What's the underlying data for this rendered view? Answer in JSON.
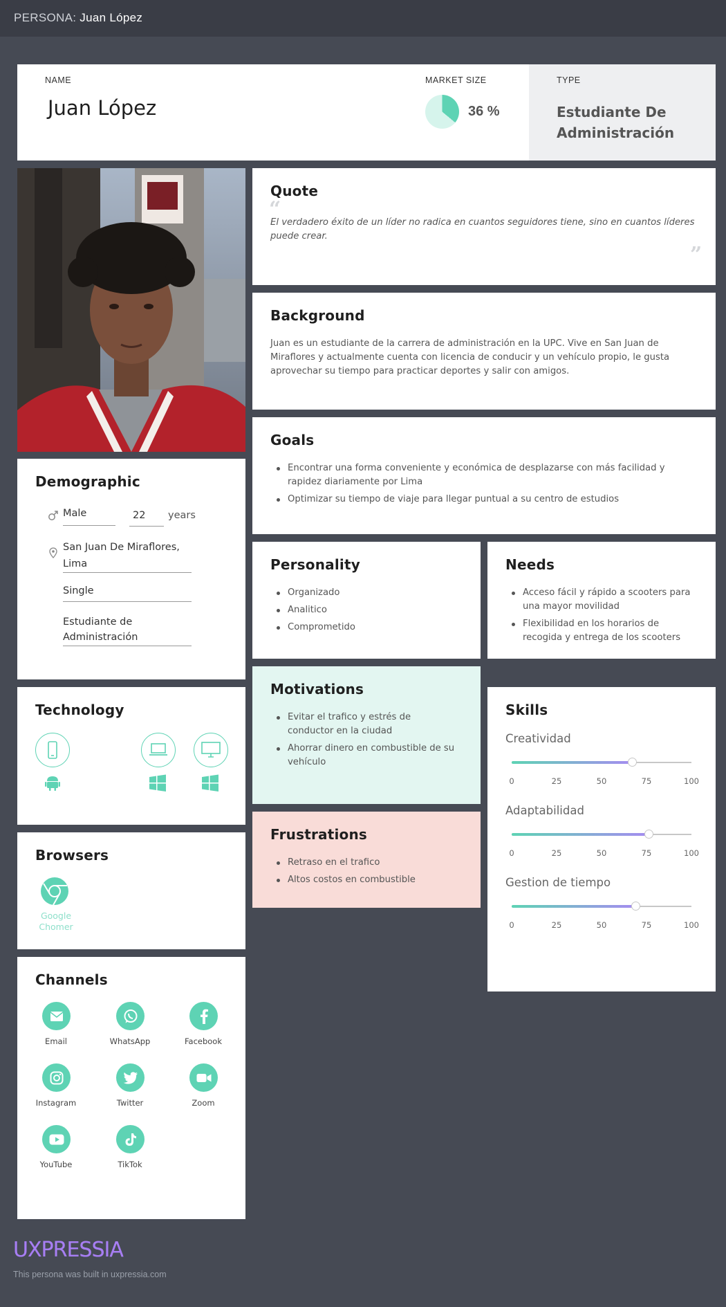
{
  "topbar": {
    "prefix": "PERSONA:",
    "name": "Juan López"
  },
  "header": {
    "name_label": "NAME",
    "name": "Juan López",
    "market_label": "MARKET SIZE",
    "market_value": "36 %",
    "market_fraction": 0.36,
    "type_label": "TYPE",
    "type_value": "Estudiante De Administración"
  },
  "quote": {
    "title": "Quote",
    "text": "El verdadero éxito de un líder no radica en cuantos seguidores tiene, sino en cuantos líderes puede crear."
  },
  "background": {
    "title": "Background",
    "text": "Juan es un estudiante de la carrera de administración en la UPC. Vive en San Juan de Miraflores y actualmente cuenta con licencia de conducir y un vehículo propio, le gusta aprovechar su tiempo para practicar deportes y salir con amigos."
  },
  "goals": {
    "title": "Goals",
    "items": [
      "Encontrar una forma conveniente y económica de desplazarse con más facilidad y rapidez diariamente por Lima",
      "Optimizar su tiempo de viaje para llegar puntual a su centro de estudios"
    ]
  },
  "personality": {
    "title": "Personality",
    "items": [
      "Organizado",
      "Analitico",
      "Comprometido"
    ]
  },
  "needs": {
    "title": "Needs",
    "items": [
      "Acceso fácil y rápido a scooters para una mayor movilidad",
      "Flexibilidad en los horarios de recogida y entrega de los scooters"
    ]
  },
  "motivations": {
    "title": "Motivations",
    "items": [
      "Evitar el trafico y estrés de conductor en la ciudad",
      "Ahorrar dinero en combustible de su vehículo"
    ]
  },
  "frustrations": {
    "title": "Frustrations",
    "items": [
      "Retraso en el trafico",
      "Altos costos en combustible"
    ]
  },
  "demographic": {
    "title": "Demographic",
    "gender": "Male",
    "age": "22",
    "age_unit": "years",
    "location_line1": "San Juan De Miraflores,",
    "location_line2": "Lima",
    "status": "Single",
    "occupation_line1": "Estudiante de",
    "occupation_line2": "Administración"
  },
  "technology": {
    "title": "Technology",
    "devices": [
      {
        "device": "smartphone-icon",
        "os": "android-icon"
      },
      {
        "device": "laptop-icon",
        "os": "windows-icon"
      },
      {
        "device": "desktop-icon",
        "os": "windows-icon"
      }
    ]
  },
  "browsers": {
    "title": "Browsers",
    "label_line1": "Google",
    "label_line2": "Chomer"
  },
  "channels": {
    "title": "Channels",
    "items": [
      "Email",
      "WhatsApp",
      "Facebook",
      "Instagram",
      "Twitter",
      "Zoom",
      "YouTube",
      "TikTok"
    ]
  },
  "skills": {
    "title": "Skills",
    "items": [
      {
        "name": "Creatividad",
        "value": 67
      },
      {
        "name": "Adaptabilidad",
        "value": 76
      },
      {
        "name": "Gestion de tiempo",
        "value": 69
      }
    ],
    "ticks": [
      "0",
      "25",
      "50",
      "75",
      "100"
    ]
  },
  "footer": {
    "brand": "UXPRESSIA",
    "built": "This persona was built in uxpressia.com"
  },
  "colors": {
    "accent": "#5ed3b4",
    "motivations_bg": "#e3f6f1",
    "frustrations_bg": "#f9dcd8",
    "dark_bg": "#464a54"
  }
}
